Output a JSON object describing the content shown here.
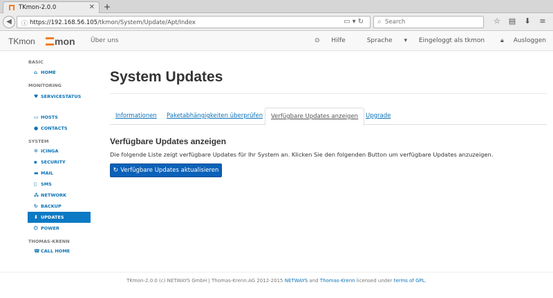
{
  "browser": {
    "tab_title": "TKmon-2.0.0",
    "url_host": "https://192.168.56.105",
    "url_path": "/tkmon/System/Update/Apt/Index",
    "search_placeholder": "Search"
  },
  "header": {
    "brand": "TKmon",
    "logo_text": "mon",
    "about": "Über uns",
    "help": "Hilfe",
    "language": "Sprache",
    "logged_in": "Eingeloggt als tkmon",
    "logout": "Ausloggen"
  },
  "sidebar": {
    "basic": "BASIC",
    "home": "HOME",
    "monitoring": "MONITORING",
    "servicestatus": "SERVICESTATUS",
    "hosts": "HOSTS",
    "contacts": "CONTACTS",
    "system": "SYSTEM",
    "icinga": "ICINGA",
    "security": "SECURITY",
    "mail": "MAIL",
    "sms": "SMS",
    "network": "NETWORK",
    "backup": "BACKUP",
    "updates": "UPDATES",
    "power": "POWER",
    "thomas_krenn": "THOMAS-KRENN",
    "call_home": "CALL HOME"
  },
  "main": {
    "title": "System Updates",
    "tabs": [
      "Informationen",
      "Paketabhängigkeiten überprüfen",
      "Verfügbare Updates anzeigen",
      "Upgrade"
    ],
    "section_title": "Verfügbare Updates anzeigen",
    "section_text": "Die folgende Liste zeigt verfügbare Updates für Ihr System an. Klicken Sie den folgenden Button um verfügbare Updates anzuzeigen.",
    "button": "Verfügbare Updates aktualisieren"
  },
  "footer": {
    "text_1": "TKmon-2.0.0 (c) NETWAYS GmbH | Thomas-Krenn.AG 2012-2015 ",
    "netways": "NETWAYS",
    "and": " and ",
    "thomas_krenn": "Thomas-Krenn",
    "licensed": " licensed under ",
    "terms": "terms of GPL",
    "end": "."
  }
}
